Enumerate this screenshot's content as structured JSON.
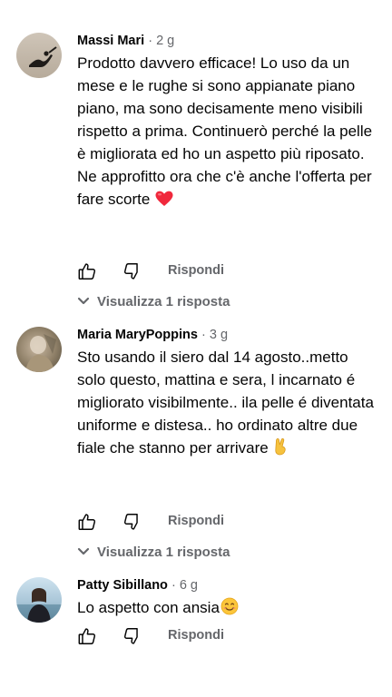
{
  "comments": [
    {
      "author": "Massi Mari",
      "separator": "·",
      "time": "2 g",
      "text_1": "Prodotto davvero efficace! Lo uso da un mese e le rughe si sono appianate piano piano, ma sono decisamente meno visibili rispetto a prima. Continuerò perché la pelle è migliorata ed ho un aspetto più riposato.",
      "text_2": "Ne approfitto ora che c'è anche l'offerta per fare scorte",
      "emoji": "heart-emoji",
      "like_icon": "thumbs-up-icon",
      "dislike_icon": "thumbs-down-icon",
      "reply_label": "Rispondi",
      "view_replies_label": "Visualizza 1 risposta"
    },
    {
      "author": "Maria MaryPoppins",
      "separator": "·",
      "time": "3 g",
      "text_1": "Sto usando il siero dal 14 agosto..metto solo questo, mattina e sera, l incarnato é migliorato visibilmente.. ila pelle é diventata uniforme e distesa.. ho ordinato altre due fiale che stanno per arrivare",
      "emoji": "victory-hand-emoji",
      "like_icon": "thumbs-up-icon",
      "dislike_icon": "thumbs-down-icon",
      "reply_label": "Rispondi",
      "view_replies_label": "Visualizza 1 risposta"
    },
    {
      "author": "Patty Sibillano",
      "separator": "·",
      "time": "6 g",
      "text_1": "Lo aspetto con ansia",
      "emoji": "smiling-face-emoji",
      "like_icon": "thumbs-up-icon",
      "dislike_icon": "thumbs-down-icon",
      "reply_label": "Rispondi"
    }
  ],
  "colors": {
    "text": "#050505",
    "secondary": "#65676b",
    "heart": "#f0283c"
  }
}
